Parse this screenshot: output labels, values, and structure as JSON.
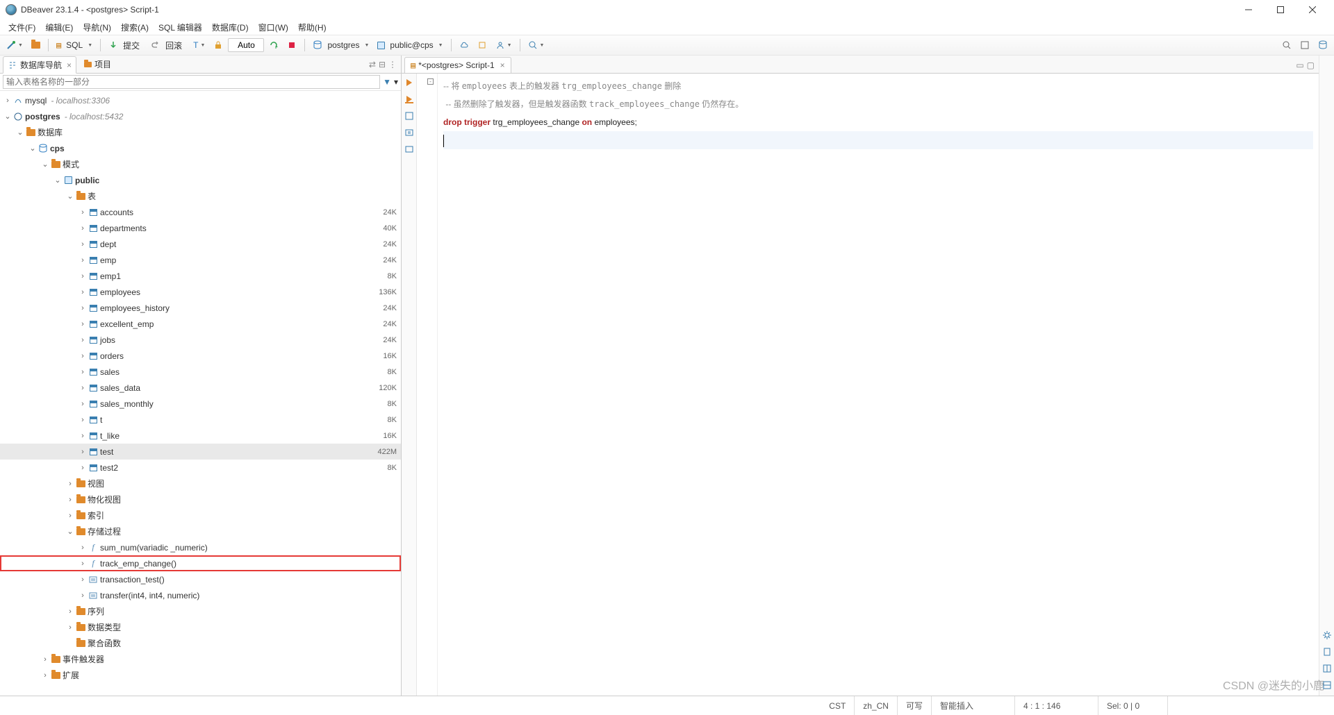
{
  "window": {
    "title": "DBeaver 23.1.4 - <postgres> Script-1"
  },
  "menu": {
    "file": "文件(F)",
    "edit": "编辑(E)",
    "navigate": "导航(N)",
    "search": "搜索(A)",
    "sqlEditor": "SQL 编辑器",
    "database": "数据库(D)",
    "window": "窗口(W)",
    "help": "帮助(H)"
  },
  "toolbar": {
    "sql": "SQL",
    "commit": "提交",
    "rollback": "回滚",
    "auto": "Auto",
    "conn": "postgres",
    "schema": "public@cps"
  },
  "nav": {
    "tabs": {
      "navigator": "数据库导航",
      "project": "项目"
    },
    "filterPlaceholder": "输入表格名称的一部分",
    "mysql": {
      "label": "mysql",
      "host": "- localhost:3306"
    },
    "postgres": {
      "label": "postgres",
      "host": "- localhost:5432"
    },
    "folders": {
      "databases": "数据库",
      "schemas": "模式",
      "public": "public",
      "tables": "表",
      "views": "视图",
      "matviews": "物化视图",
      "indexes": "索引",
      "procs": "存储过程",
      "sequences": "序列",
      "datatypes": "数据类型",
      "aggregates": "聚合函数",
      "eventTriggers": "事件触发器",
      "extensions": "扩展"
    },
    "db": "cps",
    "tablesList": [
      {
        "n": "accounts",
        "s": "24K"
      },
      {
        "n": "departments",
        "s": "40K"
      },
      {
        "n": "dept",
        "s": "24K"
      },
      {
        "n": "emp",
        "s": "24K"
      },
      {
        "n": "emp1",
        "s": "8K"
      },
      {
        "n": "employees",
        "s": "136K"
      },
      {
        "n": "employees_history",
        "s": "24K"
      },
      {
        "n": "excellent_emp",
        "s": "24K"
      },
      {
        "n": "jobs",
        "s": "24K"
      },
      {
        "n": "orders",
        "s": "16K"
      },
      {
        "n": "sales",
        "s": "8K"
      },
      {
        "n": "sales_data",
        "s": "120K"
      },
      {
        "n": "sales_monthly",
        "s": "8K"
      },
      {
        "n": "t",
        "s": "8K"
      },
      {
        "n": "t_like",
        "s": "16K"
      },
      {
        "n": "test",
        "s": "422M"
      },
      {
        "n": "test2",
        "s": "8K"
      }
    ],
    "procs": [
      {
        "n": "sum_num(variadic _numeric)",
        "k": "f"
      },
      {
        "n": "track_emp_change()",
        "k": "f",
        "hl": true
      },
      {
        "n": "transaction_test()",
        "k": "p"
      },
      {
        "n": "transfer(int4, int4, numeric)",
        "k": "p"
      }
    ]
  },
  "editor": {
    "tabLabel": "*<postgres> Script-1",
    "lines": {
      "c1a": "-- 将 ",
      "c1b": "employees",
      "c1c": " 表上的触发器 ",
      "c1d": "trg_employees_change",
      "c1e": " 删除",
      "c2a": " -- 虽然删除了触发器，但是触发器函数 ",
      "c2b": "track_employees_change",
      "c2c": " 仍然存在。",
      "k_drop": "drop",
      "k_trigger": "trigger",
      "t_trg": " trg_employees_change ",
      "k_on": "on",
      "t_emp": " employees",
      "semi": ";"
    }
  },
  "status": {
    "tz": "CST",
    "locale": "zh_CN",
    "mode": "可写",
    "insert": "智能插入",
    "pos": "4 : 1 : 146",
    "sel": "Sel: 0 | 0"
  },
  "watermark": "CSDN @迷失的小鹿"
}
